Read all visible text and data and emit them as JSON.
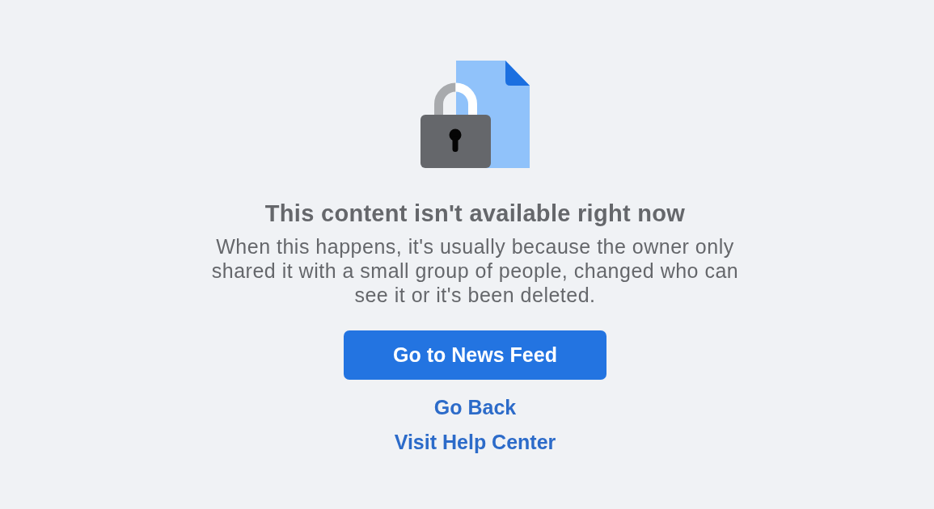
{
  "message": {
    "title": "This content isn't available right now",
    "body": "When this happens, it's usually because the owner only shared it with a small group of people, changed who can see it or it's been deleted."
  },
  "primary_button": {
    "label": "Go to News Feed"
  },
  "links": [
    {
      "label": "Go Back"
    },
    {
      "label": "Visit Help Center"
    }
  ]
}
